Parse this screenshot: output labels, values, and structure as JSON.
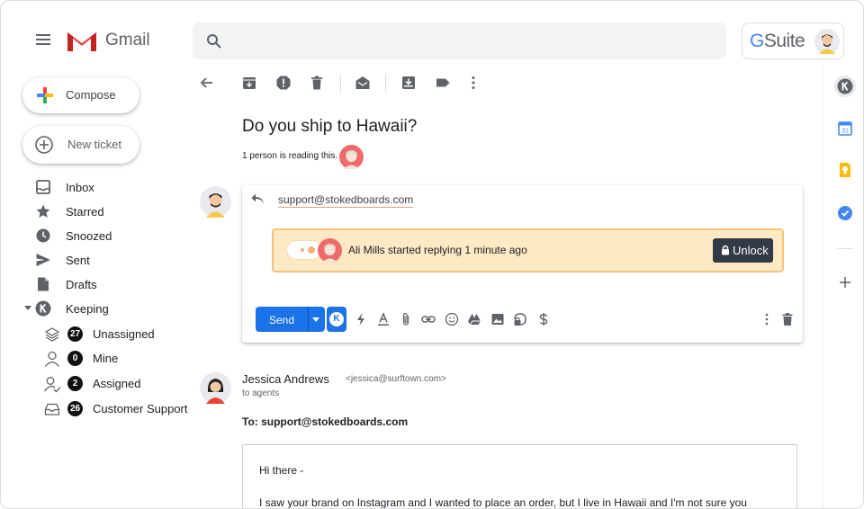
{
  "app": {
    "brand": "Gmail",
    "gsuite_g": "G",
    "gsuite_suite": "Suite"
  },
  "nav": {
    "compose_label": "Compose",
    "new_ticket_label": "New ticket",
    "items": [
      {
        "label": "Inbox",
        "icon": "inbox-icon"
      },
      {
        "label": "Starred",
        "icon": "star-icon"
      },
      {
        "label": "Snoozed",
        "icon": "clock-icon"
      },
      {
        "label": "Sent",
        "icon": "send-icon"
      },
      {
        "label": "Drafts",
        "icon": "draft-icon"
      },
      {
        "label": "Keeping",
        "icon": "keeping-logo-icon"
      }
    ],
    "keeping_sub": [
      {
        "label": "Unassigned",
        "count": "27",
        "icon": "layers-icon"
      },
      {
        "label": "Mine",
        "count": "0",
        "icon": "person-icon"
      },
      {
        "label": "Assigned",
        "count": "2",
        "icon": "person-check-icon"
      },
      {
        "label": "Customer Support",
        "count": "26",
        "icon": "tray-icon"
      }
    ]
  },
  "thread": {
    "subject": "Do you ship to Hawaii?",
    "reading_text": "1 person is reading this."
  },
  "reply": {
    "to": "support@stokedboards.com",
    "lock_message": "Ali Mills started replying 1 minute ago",
    "unlock_label": "Unlock",
    "send_label": "Send",
    "k_label": "K"
  },
  "message": {
    "sender_name": "Jessica Andrews",
    "sender_email": "<jessica@surftown.com>",
    "to_line": "to agents",
    "to_support": "To: support@stokedboards.com",
    "greeting": "Hi there -",
    "body_line": "I saw your brand on Instagram and I wanted to place an order, but I live in Hawaii and I'm not sure you"
  },
  "colors": {
    "accent_blue": "#1a73e8",
    "lock_bg": "#fde9c4",
    "lock_border": "#f5c27b",
    "unlock_bg": "#323a45"
  }
}
